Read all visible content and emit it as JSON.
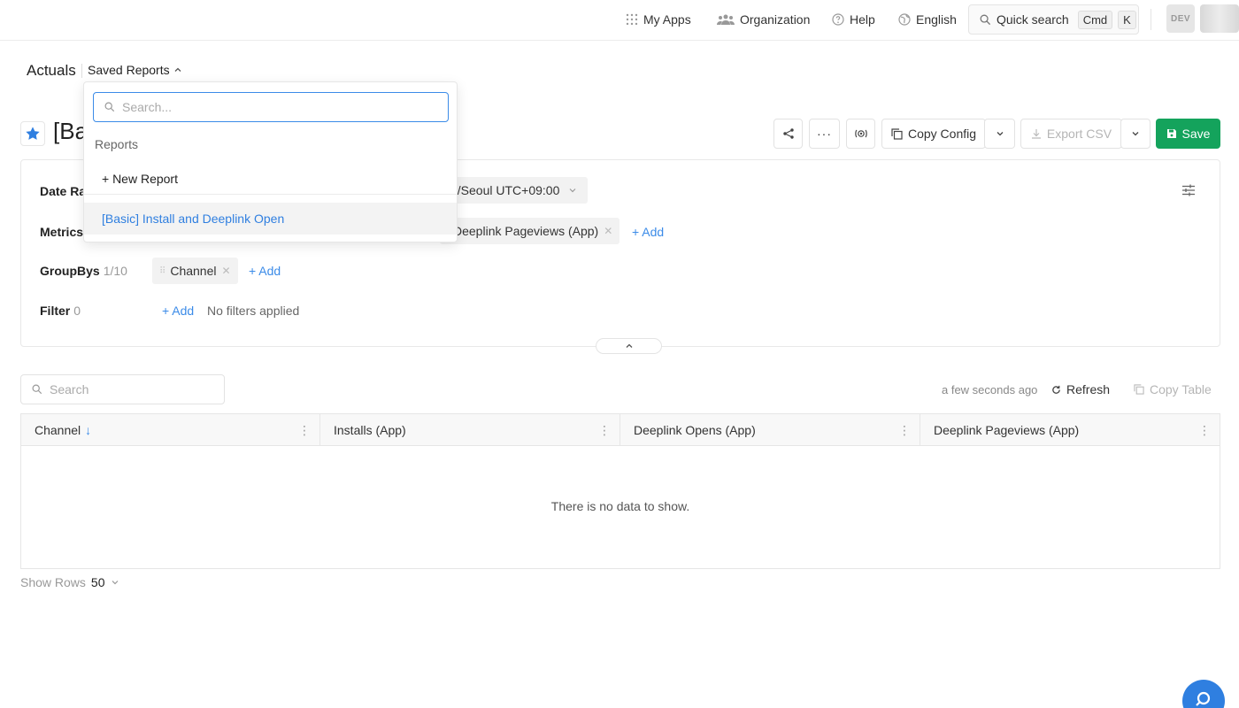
{
  "topnav": {
    "my_apps": "My Apps",
    "organization": "Organization",
    "help": "Help",
    "language": "English",
    "quick_search": "Quick search",
    "kbd_cmd": "Cmd",
    "kbd_k": "K",
    "env_badge": "DEV"
  },
  "breadcrumb": {
    "title": "Actuals",
    "saved_reports": "Saved Reports"
  },
  "report": {
    "title": "[Ba"
  },
  "toolbar": {
    "copy_config": "Copy Config",
    "export_csv": "Export CSV",
    "save": "Save"
  },
  "config": {
    "date_range_label": "Date Ra",
    "timezone": "a/Seoul UTC+09:00",
    "metrics_label": "Metrics",
    "metric_chip": "Deeplink Pageviews (App)",
    "metrics_add": "+ Add",
    "groupbys_label": "GroupBys",
    "groupbys_count": "1/10",
    "groupby_chip": "Channel",
    "groupbys_add": "+ Add",
    "filter_label": "Filter",
    "filter_count": "0",
    "filter_add": "+ Add",
    "no_filters": "No filters applied"
  },
  "table_toolbar": {
    "search_placeholder": "Search",
    "updated": "a few seconds ago",
    "refresh": "Refresh",
    "copy_table": "Copy Table"
  },
  "table": {
    "columns": [
      "Channel",
      "Installs (App)",
      "Deeplink Opens (App)",
      "Deeplink Pageviews (App)"
    ],
    "sort_indicator": "↓",
    "empty_message": "There is no data to show."
  },
  "pagination": {
    "show_rows_label": "Show Rows",
    "show_rows_value": "50"
  },
  "saved_reports_dropdown": {
    "search_placeholder": "Search...",
    "section_label": "Reports",
    "new_report": "+ New Report",
    "items": [
      "[Basic] Install and Deeplink Open"
    ]
  },
  "colors": {
    "accent": "#3b8be8",
    "primary_link": "#2f7fe0",
    "save_green": "#14a35c",
    "star_blue": "#2f7fe0"
  }
}
